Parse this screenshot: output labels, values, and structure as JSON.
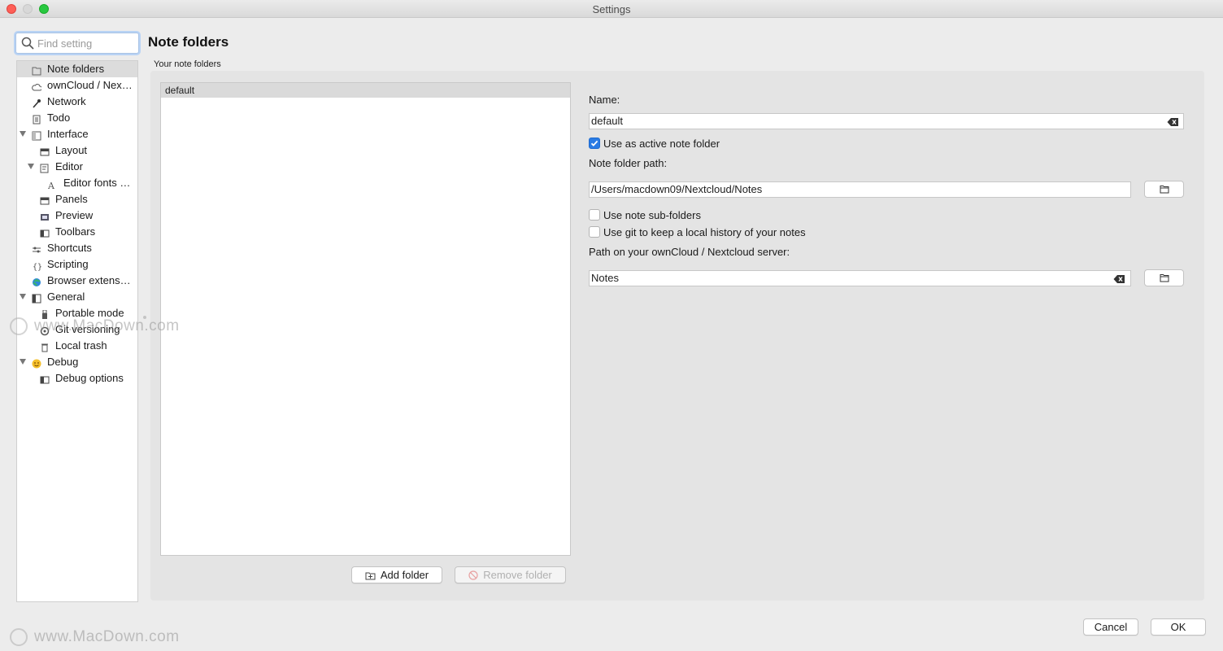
{
  "window": {
    "title": "Settings"
  },
  "search": {
    "placeholder": "Find setting",
    "value": ""
  },
  "nav": {
    "items": [
      {
        "label": "Note folders",
        "icon": "folder-icon",
        "level": 0,
        "selected": true
      },
      {
        "label": "ownCloud / Nex…",
        "icon": "cloud-icon",
        "level": 0
      },
      {
        "label": "Network",
        "icon": "network-icon",
        "level": 0
      },
      {
        "label": "Todo",
        "icon": "todo-icon",
        "level": 0
      },
      {
        "label": "Interface",
        "icon": "interface-icon",
        "level": 0,
        "expanded": true
      },
      {
        "label": "Layout",
        "icon": "layout-icon",
        "level": 1
      },
      {
        "label": "Editor",
        "icon": "editor-icon",
        "level": 1,
        "expanded": true
      },
      {
        "label": "Editor fonts …",
        "icon": "font-icon",
        "level": 2
      },
      {
        "label": "Panels",
        "icon": "panels-icon",
        "level": 1
      },
      {
        "label": "Preview",
        "icon": "preview-icon",
        "level": 1
      },
      {
        "label": "Toolbars",
        "icon": "toolbars-icon",
        "level": 1
      },
      {
        "label": "Shortcuts",
        "icon": "shortcuts-icon",
        "level": 0
      },
      {
        "label": "Scripting",
        "icon": "scripting-icon",
        "level": 0
      },
      {
        "label": "Browser extens…",
        "icon": "globe-icon",
        "level": 0
      },
      {
        "label": "General",
        "icon": "general-icon",
        "level": 0,
        "expanded": true
      },
      {
        "label": "Portable mode",
        "icon": "usb-icon",
        "level": 1
      },
      {
        "label": "Git versioning",
        "icon": "git-icon",
        "level": 1
      },
      {
        "label": "Local trash",
        "icon": "trash-icon",
        "level": 1
      },
      {
        "label": "Debug",
        "icon": "smiley-icon",
        "level": 0,
        "expanded": true
      },
      {
        "label": "Debug options",
        "icon": "debug-options-icon",
        "level": 1
      }
    ]
  },
  "page": {
    "title": "Note folders",
    "group_label": "Your note folders",
    "folders": [
      "default"
    ],
    "add_folder": "Add folder",
    "remove_folder": "Remove folder"
  },
  "form": {
    "name_label": "Name:",
    "name_value": "default",
    "active_label": "Use as active note folder",
    "active_checked": true,
    "path_label": "Note folder path:",
    "path_value": "/Users/macdown09/Nextcloud/Notes",
    "subfolders_label": "Use note sub-folders",
    "subfolders_checked": false,
    "git_label": "Use git to keep a local history of your notes",
    "git_checked": false,
    "server_label": "Path on your ownCloud / Nextcloud server:",
    "server_value": "Notes"
  },
  "footer": {
    "cancel": "Cancel",
    "ok": "OK"
  },
  "watermark": {
    "text": "www.MacDown.com"
  },
  "colors": {
    "accent": "#2a7be4",
    "selection": "#dcdcdc",
    "panel": "#e4e4e4"
  }
}
